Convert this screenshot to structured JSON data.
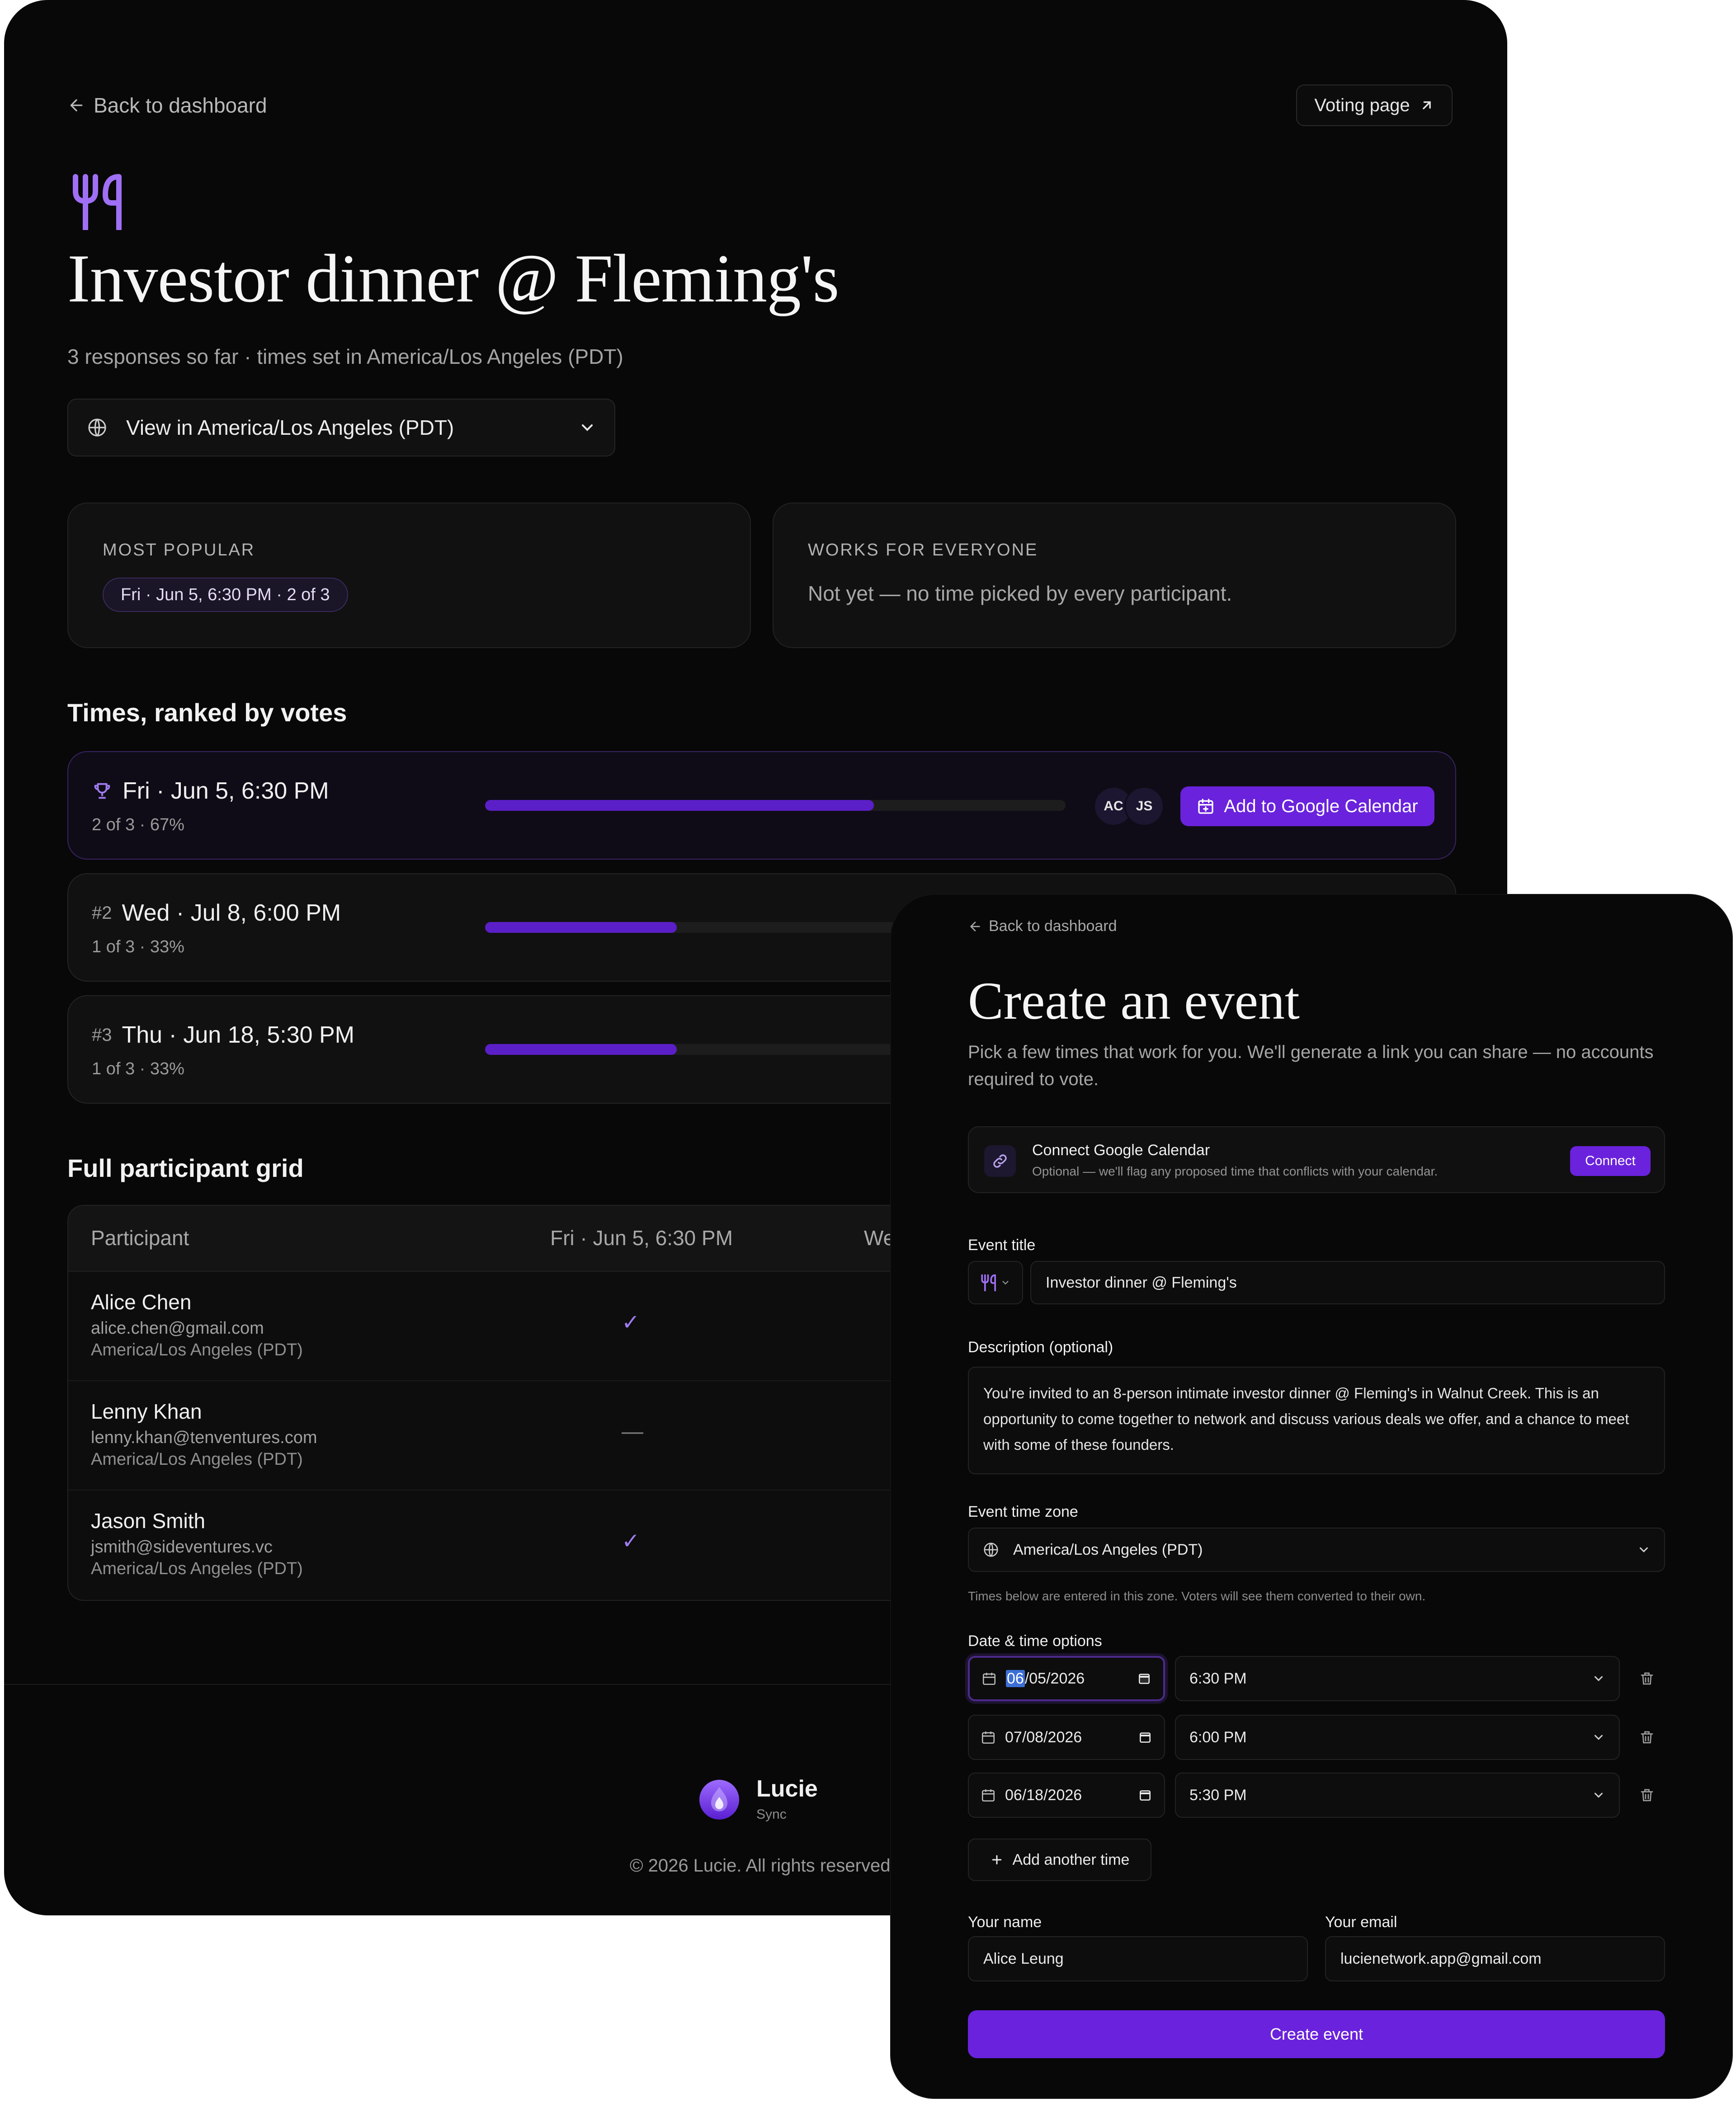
{
  "results": {
    "back_label": "Back to dashboard",
    "voting_label": "Voting page",
    "event_icon": "fork-knife-icon",
    "title": "Investor dinner @ Fleming's",
    "subtitle": "3 responses so far · times set in America/Los Angeles (PDT)",
    "view_timezone": "View in America/Los Angeles (PDT)",
    "most_popular": {
      "caption": "MOST POPULAR",
      "value": "Fri · Jun 5, 6:30 PM · 2 of 3"
    },
    "works_for_everyone": {
      "caption": "WORKS FOR EVERYONE",
      "value": "Not yet — no time picked by every participant."
    },
    "ranked_heading": "Times, ranked by votes",
    "ranked": [
      {
        "rank": "",
        "time": "Fri · Jun 5, 6:30 PM",
        "meta": "2 of 3 · 67%",
        "fraction": 0.67,
        "avatars": [
          "AC",
          "JS"
        ],
        "action": "Add to Google Calendar"
      },
      {
        "rank": "#2",
        "time": "Wed · Jul 8, 6:00 PM",
        "meta": "1 of 3 · 33%",
        "fraction": 0.33
      },
      {
        "rank": "#3",
        "time": "Thu · Jun 18, 5:30 PM",
        "meta": "1 of 3 · 33%",
        "fraction": 0.33
      }
    ],
    "grid_heading": "Full participant grid",
    "grid_columns": [
      "Participant",
      "Fri · Jun 5, 6:30 PM",
      "Wed"
    ],
    "participants": [
      {
        "name": "Alice Chen",
        "email": "alice.chen@gmail.com",
        "tz": "America/Los Angeles (PDT)",
        "mark": "✓"
      },
      {
        "name": "Lenny Khan",
        "email": "lenny.khan@tenventures.com",
        "tz": "America/Los Angeles (PDT)",
        "mark": "—"
      },
      {
        "name": "Jason Smith",
        "email": "jsmith@sideventures.vc",
        "tz": "America/Los Angeles (PDT)",
        "mark": "✓"
      }
    ],
    "brand": "Lucie",
    "brand_sub": "Sync",
    "copyright": "© 2026 Lucie. All rights reserved."
  },
  "create": {
    "back_label": "Back to dashboard",
    "title": "Create an event",
    "subtitle": "Pick a few times that work for you. We'll generate a link you can share — no accounts required to vote.",
    "connect_title": "Connect Google Calendar",
    "connect_sub": "Optional — we'll flag any proposed time that conflicts with your calendar.",
    "connect_button": "Connect",
    "event_title_label": "Event title",
    "event_title_value": "Investor dinner @ Fleming's",
    "description_label": "Description (optional)",
    "description_value": "You're invited to an 8-person intimate investor dinner @ Fleming's in Walnut Creek. This is an opportunity to come together to network and discuss various deals we offer, and a chance to meet with some of these founders.",
    "timezone_label": "Event time zone",
    "timezone_value": "America/Los Angeles (PDT)",
    "timezone_hint": "Times below are entered in this zone. Voters will see them converted to their own.",
    "options_label": "Date & time options",
    "options": [
      {
        "date_selected": "06",
        "date_rest": "/05/2026",
        "time": "6:30 PM"
      },
      {
        "date": "07/08/2026",
        "time": "6:00 PM"
      },
      {
        "date": "06/18/2026",
        "time": "5:30 PM"
      }
    ],
    "add_time_label": "Add another time",
    "name_label": "Your name",
    "name_value": "Alice Leung",
    "email_label": "Your email",
    "email_value": "lucienetwork.app@gmail.com",
    "submit_label": "Create event"
  },
  "colors": {
    "accent": "#6a22dc",
    "bar": "#5b1fc7",
    "icon": "#9f7df0",
    "background": "#080808"
  }
}
